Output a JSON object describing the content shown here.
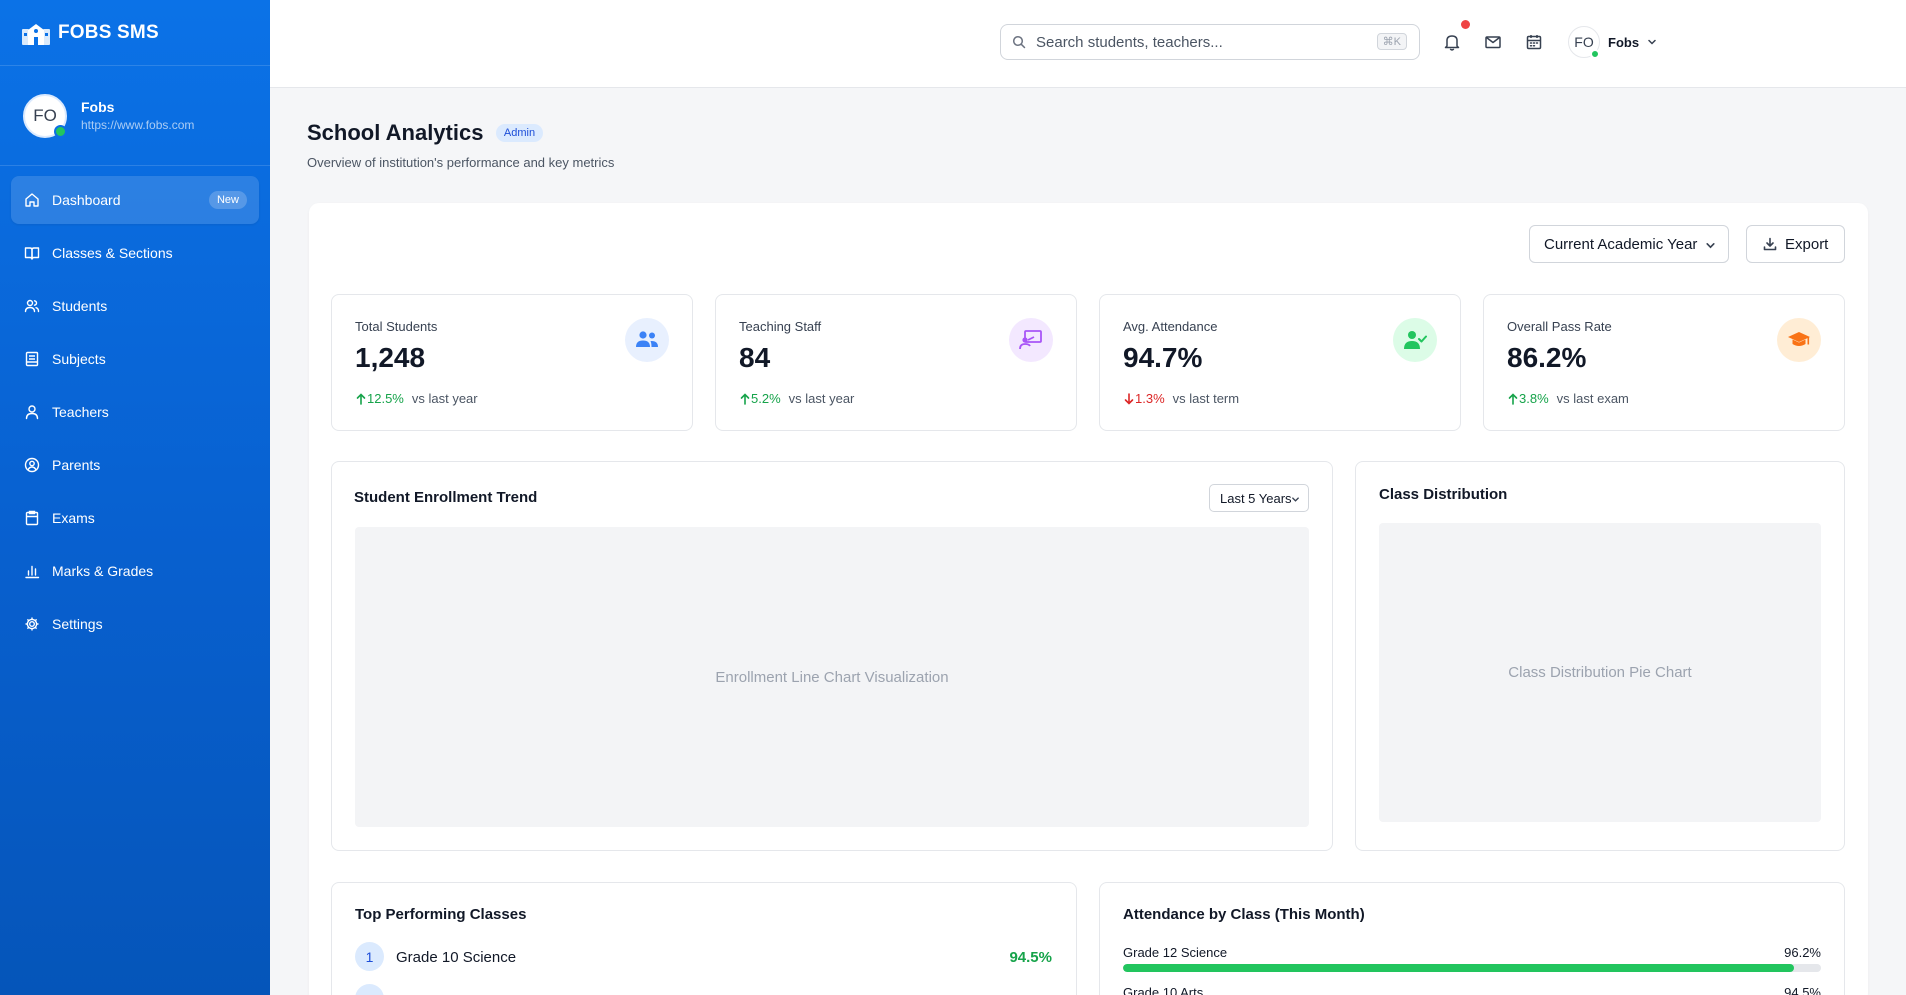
{
  "brand": {
    "name": "FOBS SMS"
  },
  "profile": {
    "initials": "FO",
    "name": "Fobs",
    "url": "https://www.fobs.com"
  },
  "sidebar": {
    "items": [
      {
        "label": "Dashboard",
        "badge": "New"
      },
      {
        "label": "Classes & Sections"
      },
      {
        "label": "Students"
      },
      {
        "label": "Subjects"
      },
      {
        "label": "Teachers"
      },
      {
        "label": "Parents"
      },
      {
        "label": "Exams"
      },
      {
        "label": "Marks & Grades"
      },
      {
        "label": "Settings"
      }
    ]
  },
  "header": {
    "search_placeholder": "Search students, teachers...",
    "search_shortcut": "⌘K",
    "user_initials": "FO",
    "user_name": "Fobs"
  },
  "page": {
    "title": "School Analytics",
    "role_badge": "Admin",
    "subtitle": "Overview of institution's performance and key metrics"
  },
  "toolbar": {
    "period_select": "Current Academic Year",
    "export_label": "Export"
  },
  "stats": [
    {
      "label": "Total Students",
      "value": "1,248",
      "delta": "12.5%",
      "direction": "up",
      "note": "vs last year",
      "icon": "users-icon",
      "icon_color": "#3b82f6",
      "icon_bg": "#e8f0fe"
    },
    {
      "label": "Teaching Staff",
      "value": "84",
      "delta": "5.2%",
      "direction": "up",
      "note": "vs last year",
      "icon": "presentation-icon",
      "icon_color": "#a855f7",
      "icon_bg": "#f3e8ff"
    },
    {
      "label": "Avg. Attendance",
      "value": "94.7%",
      "delta": "1.3%",
      "direction": "down",
      "note": "vs last term",
      "icon": "user-check-icon",
      "icon_color": "#22c55e",
      "icon_bg": "#dcfce7"
    },
    {
      "label": "Overall Pass Rate",
      "value": "86.2%",
      "delta": "3.8%",
      "direction": "up",
      "note": "vs last exam",
      "icon": "graduation-cap-icon",
      "icon_color": "#f97316",
      "icon_bg": "#ffedd5"
    }
  ],
  "enrollment_card": {
    "title": "Student Enrollment Trend",
    "range_select": "Last 5 Years",
    "placeholder": "Enrollment Line Chart Visualization"
  },
  "distribution_card": {
    "title": "Class Distribution",
    "placeholder": "Class Distribution Pie Chart"
  },
  "top_classes": {
    "title": "Top Performing Classes",
    "rows": [
      {
        "rank": "1",
        "name": "Grade 10 Science",
        "value": "94.5%"
      }
    ]
  },
  "attendance": {
    "title": "Attendance by Class (This Month)",
    "rows": [
      {
        "label": "Grade 12 Science",
        "value": "96.2%",
        "percent": 96.2
      },
      {
        "label": "Grade 10 Arts",
        "value": "94.5%",
        "percent": 94.5
      }
    ]
  },
  "colors": {
    "sidebar": "#0b72e7",
    "accent": "#2563eb",
    "positive": "#16a34a",
    "negative": "#dc2626",
    "bar": "#22c55e"
  }
}
